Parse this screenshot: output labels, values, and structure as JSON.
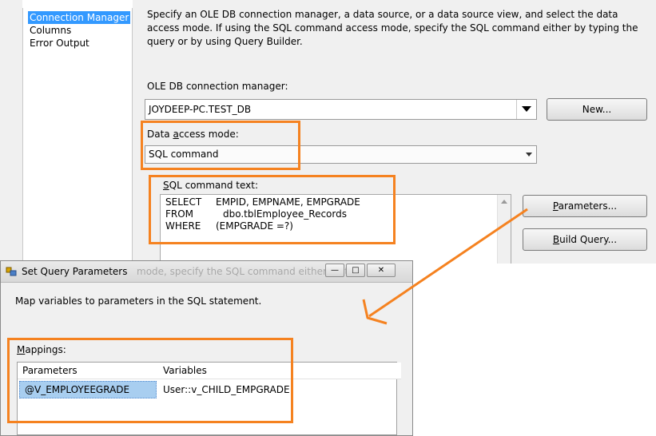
{
  "nav": {
    "items": [
      {
        "label": "Connection Manager",
        "selected": true
      },
      {
        "label": "Columns",
        "selected": false
      },
      {
        "label": "Error Output",
        "selected": false
      }
    ]
  },
  "main": {
    "description": "Specify an OLE DB connection manager, a data source, or a data source view, and select the data access mode. If using the SQL command access mode, specify the SQL command either by typing the query or by using Query Builder.",
    "connection_manager_label": "OLE DB connection manager:",
    "connection_manager_value": "JOYDEEP-PC.TEST_DB",
    "new_button": "New...",
    "access_mode_label_pre": "Data ",
    "access_mode_label_u": "a",
    "access_mode_label_post": "ccess mode:",
    "access_mode_value": "SQL command",
    "sql_label_u": "S",
    "sql_label_rest": "QL command text:",
    "sql_lines": [
      {
        "kw": "SELECT",
        "rest": "EMPID, EMPNAME, EMPGRADE"
      },
      {
        "kw": "FROM",
        "rest": "dbo.tblEmployee_Records"
      },
      {
        "kw": "WHERE",
        "rest": "(EMPGRADE =?)"
      }
    ],
    "parameters_button_u": "P",
    "parameters_button_rest": "arameters...",
    "build_query_button_u": "B",
    "build_query_button_rest": "uild Query..."
  },
  "dialog": {
    "title": "Set Query Parameters",
    "ghost_text": "mode, specify the SQL command either by t",
    "instruction": "Map variables to parameters in the SQL statement.",
    "mappings_label_u": "M",
    "mappings_label_rest": "appings:",
    "columns": [
      "Parameters",
      "Variables"
    ],
    "rows": [
      {
        "parameter": "@V_EMPLOYEEGRADE",
        "variable": "User::v_CHILD_EMPGRADE"
      }
    ]
  },
  "colors": {
    "annotation": "#f58220",
    "selection": "#3399ff"
  }
}
